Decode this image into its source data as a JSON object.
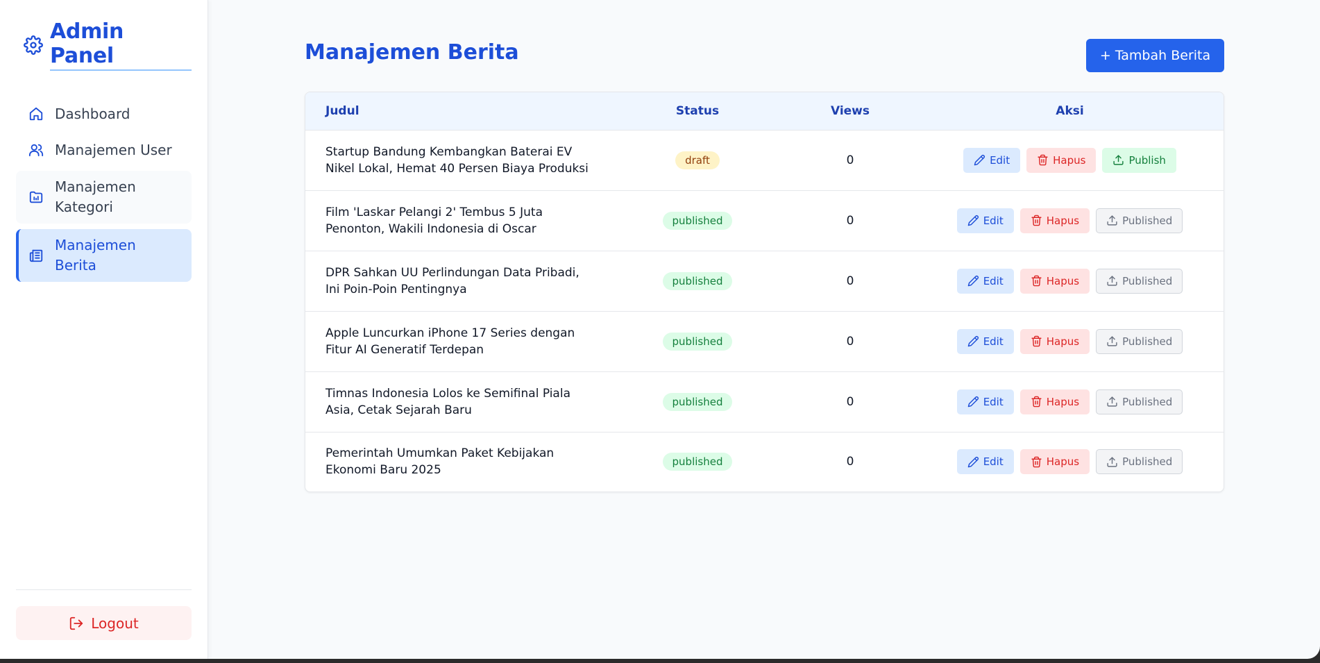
{
  "sidebar": {
    "brand_title": "Admin Panel",
    "items": [
      {
        "label": "Dashboard",
        "icon": "home-icon"
      },
      {
        "label": "Manajemen User",
        "icon": "users-icon"
      },
      {
        "label": "Manajemen Kategori",
        "icon": "category-chart-icon"
      },
      {
        "label": "Manajemen Berita",
        "icon": "newspaper-icon",
        "active": true
      }
    ],
    "logout_label": "Logout"
  },
  "main": {
    "title": "Manajemen Berita",
    "add_button_label": "+ Tambah Berita",
    "table": {
      "columns": [
        "Judul",
        "Status",
        "Views",
        "Aksi"
      ],
      "rows": [
        {
          "judul": "Startup Bandung Kembangkan Baterai EV Nikel Lokal, Hemat 40 Persen Biaya Produksi",
          "status": "draft",
          "views": "0",
          "publish_label": "Publish"
        },
        {
          "judul": "Film 'Laskar Pelangi 2' Tembus 5 Juta Penonton, Wakili Indonesia di Oscar",
          "status": "published",
          "views": "0",
          "publish_label": "Published"
        },
        {
          "judul": "DPR Sahkan UU Perlindungan Data Pribadi, Ini Poin-Poin Pentingnya",
          "status": "published",
          "views": "0",
          "publish_label": "Published"
        },
        {
          "judul": "Apple Luncurkan iPhone 17 Series dengan Fitur AI Generatif Terdepan",
          "status": "published",
          "views": "0",
          "publish_label": "Published"
        },
        {
          "judul": "Timnas Indonesia Lolos ke Semifinal Piala Asia, Cetak Sejarah Baru",
          "status": "published",
          "views": "0",
          "publish_label": "Published"
        },
        {
          "judul": "Pemerintah Umumkan Paket Kebijakan Ekonomi Baru 2025",
          "status": "published",
          "views": "0",
          "publish_label": "Published"
        }
      ],
      "edit_label": "Edit",
      "hapus_label": "Hapus"
    }
  },
  "colors": {
    "accent": "#1d4ed8",
    "primary_button": "#2563eb",
    "draft_bg": "#fef3c7",
    "published_bg": "#dcfce7",
    "danger": "#dc2626"
  }
}
